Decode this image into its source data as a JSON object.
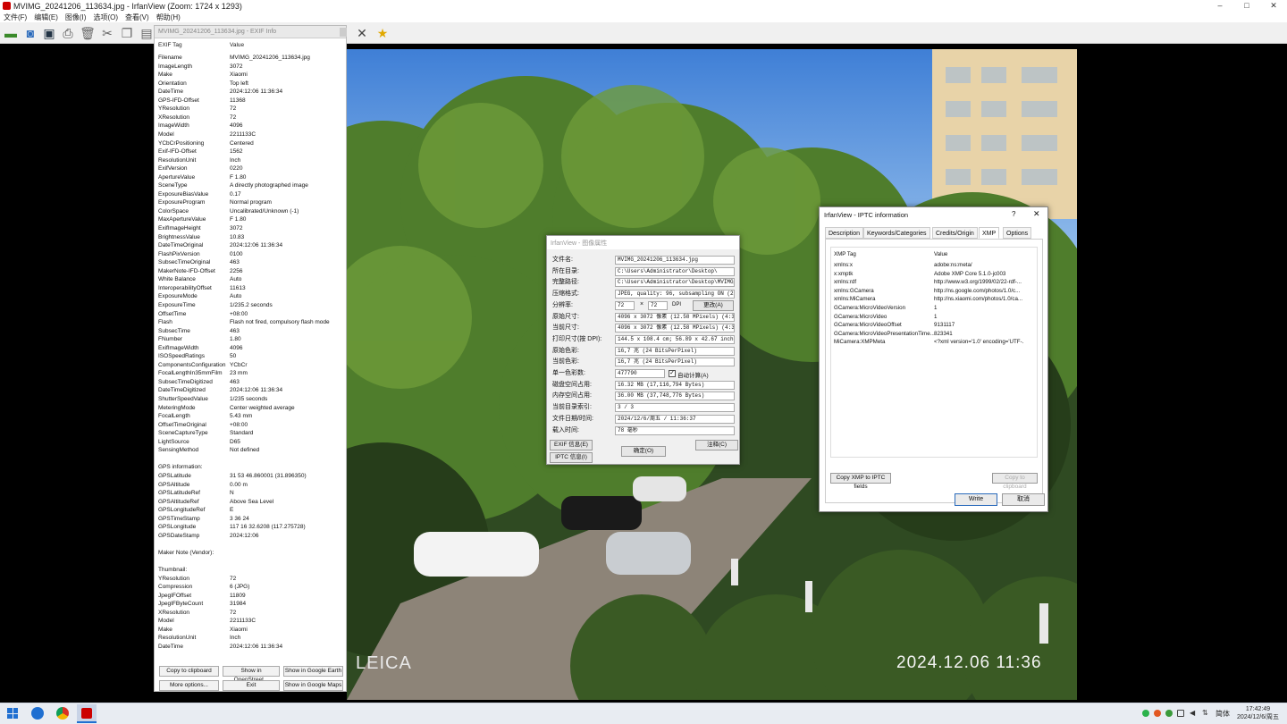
{
  "app": {
    "title": "MVIMG_20241206_113634.jpg - IrfanView (Zoom: 1724 x 1293)",
    "window_buttons": [
      "–",
      "□",
      "✕"
    ],
    "menu": [
      "文件(F)",
      "编辑(E)",
      "图像(I)",
      "选项(O)",
      "查看(V)",
      "帮助(H)"
    ]
  },
  "exif": {
    "title": "MVIMG_20241206_113634.jpg - EXIF Info",
    "col_tag": "EXIF Tag",
    "col_value": "Value",
    "rows": [
      [
        "Filename",
        "MVIMG_20241206_113634.jpg"
      ],
      [
        "ImageLength",
        "3072"
      ],
      [
        "Make",
        "Xiaomi"
      ],
      [
        "Orientation",
        "Top left"
      ],
      [
        "DateTime",
        "2024:12:06 11:36:34"
      ],
      [
        "GPS-IFD-Offset",
        "11368"
      ],
      [
        "YResolution",
        "72"
      ],
      [
        "XResolution",
        "72"
      ],
      [
        "ImageWidth",
        "4096"
      ],
      [
        "Model",
        "2211133C"
      ],
      [
        "YCbCrPositioning",
        "Centered"
      ],
      [
        "Exif-IFD-Offset",
        "1562"
      ],
      [
        "ResolutionUnit",
        "Inch"
      ],
      [
        "ExifVersion",
        "0220"
      ],
      [
        "ApertureValue",
        "F 1.80"
      ],
      [
        "SceneType",
        "A directly photographed image"
      ],
      [
        "ExposureBiasValue",
        "0.17"
      ],
      [
        "ExposureProgram",
        "Normal program"
      ],
      [
        "ColorSpace",
        "Uncalibrated/Unknown (-1)"
      ],
      [
        "MaxApertureValue",
        "F 1.80"
      ],
      [
        "ExifImageHeight",
        "3072"
      ],
      [
        "BrightnessValue",
        "10.83"
      ],
      [
        "DateTimeOriginal",
        "2024:12:06 11:36:34"
      ],
      [
        "FlashPixVersion",
        "0100"
      ],
      [
        "SubsecTimeOriginal",
        "463"
      ],
      [
        "MakerNote-IFD-Offset",
        "2256"
      ],
      [
        "White Balance",
        "Auto"
      ],
      [
        "InteroperabilityOffset",
        "11613"
      ],
      [
        "ExposureMode",
        "Auto"
      ],
      [
        "ExposureTime",
        "1/235.2 seconds"
      ],
      [
        "OffsetTime",
        "+08:00"
      ],
      [
        "Flash",
        "Flash not fired, compulsory flash mode"
      ],
      [
        "SubsecTime",
        "463"
      ],
      [
        "FNumber",
        "1.80"
      ],
      [
        "ExifImageWidth",
        "4096"
      ],
      [
        "ISOSpeedRatings",
        "50"
      ],
      [
        "ComponentsConfiguration",
        "YCbCr"
      ],
      [
        "FocalLengthIn35mmFilm",
        "23 mm"
      ],
      [
        "SubsecTimeDigitized",
        "463"
      ],
      [
        "DateTimeDigitized",
        "2024:12:06 11:36:34"
      ],
      [
        "ShutterSpeedValue",
        "1/235 seconds"
      ],
      [
        "MeteringMode",
        "Center weighted average"
      ],
      [
        "FocalLength",
        "5.43 mm"
      ],
      [
        "OffsetTimeOriginal",
        "+08:00"
      ],
      [
        "SceneCaptureType",
        "Standard"
      ],
      [
        "LightSource",
        "D65"
      ],
      [
        "SensingMethod",
        "Not defined"
      ],
      [
        "",
        ""
      ],
      [
        "GPS information:",
        ""
      ],
      [
        "GPSLatitude",
        "31  53  46.860001 (31.896350)"
      ],
      [
        "GPSAltitude",
        "0.00 m"
      ],
      [
        "GPSLatitudeRef",
        "N"
      ],
      [
        "GPSAltitudeRef",
        "Above Sea Level"
      ],
      [
        "GPSLongitudeRef",
        "E"
      ],
      [
        "GPSTimeStamp",
        "3  36  24"
      ],
      [
        "GPSLongitude",
        "117  16  32.6208 (117.275728)"
      ],
      [
        "GPSDateStamp",
        "2024:12:06"
      ],
      [
        "",
        ""
      ],
      [
        "Maker Note (Vendor):",
        ""
      ],
      [
        "",
        ""
      ],
      [
        "Thumbnail:",
        ""
      ],
      [
        "YResolution",
        "72"
      ],
      [
        "Compression",
        "6 (JPG)"
      ],
      [
        "JpegIFOffset",
        "11809"
      ],
      [
        "JpegIFByteCount",
        "31984"
      ],
      [
        "XResolution",
        "72"
      ],
      [
        "Model",
        "2211133C"
      ],
      [
        "Make",
        "Xiaomi"
      ],
      [
        "ResolutionUnit",
        "Inch"
      ],
      [
        "DateTime",
        "2024:12:06 11:36:34"
      ]
    ],
    "buttons": {
      "copy": "Copy to clipboard",
      "openstreet": "Show in OpenStreet...",
      "google_earth": "Show in Google Earth",
      "more": "More options...",
      "exit": "Exit",
      "google_maps": "Show in Google Maps"
    }
  },
  "props": {
    "title": "IrfanView - 图像属性",
    "rows": [
      [
        "文件名:",
        "MVIMG_20241206_113634.jpg"
      ],
      [
        "所在目录:",
        "C:\\Users\\Administrator\\Desktop\\"
      ],
      [
        "完整路径:",
        "C:\\Users\\Administrator\\Desktop\\MVIMG_20"
      ],
      [
        "压缩格式:",
        "JPEG, quality: 96, subsampling ON (2x2)"
      ],
      [
        "分辨率:",
        ""
      ],
      [
        "原始尺寸:",
        "4096 x 3072  像素 (12.58 MPixels) (4:3)"
      ],
      [
        "当前尺寸:",
        "4096 x 3072  像素 (12.58 MPixels) (4:3)"
      ],
      [
        "打印尺寸(按 DPI):",
        "144.5 x 108.4 cm; 56.89 x 42.67 inches"
      ],
      [
        "原始色彩:",
        "16,7 兆   (24 BitsPerPixel)"
      ],
      [
        "当前色彩:",
        "16,7 兆   (24 BitsPerPixel)"
      ],
      [
        "单一色彩数:",
        ""
      ],
      [
        "磁盘空间占用:",
        "16.32 MB (17,116,794 Bytes)"
      ],
      [
        "内存空间占用:",
        "36.00  MB (37,748,776 Bytes)"
      ],
      [
        "当前目录索引:",
        "3  /  3"
      ],
      [
        "文件日期/时间:",
        "2024/12/6/周五 / 11:36:37"
      ],
      [
        "载入时间:",
        "78 毫秒"
      ]
    ],
    "dpi_x": "72",
    "dpi_y": "72",
    "dpi_label": "DPI",
    "change_btn": "更改(A)",
    "unique_colors": "477790",
    "auto_calc": "自动计算(A)",
    "exif_btn": "EXIF 信息(E)",
    "iptc_btn": "IPTC 信息(I)",
    "ok_btn": "确定(O)",
    "comment_btn": "注释(C)"
  },
  "iptc": {
    "title": "IrfanView - IPTC information",
    "help": "?",
    "close": "✕",
    "tabs": [
      "Description",
      "Keywords/Categories",
      "Credits/Origin",
      "XMP",
      "Options"
    ],
    "col_tag": "XMP Tag",
    "col_value": "Value",
    "rows": [
      [
        "xmlns:x",
        "adobe:ns:meta/"
      ],
      [
        "x:xmptk",
        "Adobe XMP Core 5.1.0-jc003"
      ],
      [
        "xmlns:rdf",
        "http://www.w3.org/1999/02/22-rdf-..."
      ],
      [
        "xmlns:GCamera",
        "http://ns.google.com/photos/1.0/c..."
      ],
      [
        "xmlns:MiCamera",
        "http://ns.xiaomi.com/photos/1.0/ca..."
      ],
      [
        "GCamera:MicroVideoVersion",
        "1"
      ],
      [
        "GCamera:MicroVideo",
        "1"
      ],
      [
        "GCamera:MicroVideoOffset",
        "9131117"
      ],
      [
        "GCamera:MicroVideoPresentationTime...",
        "823341"
      ],
      [
        "MiCamera:XMPMeta",
        "<?xml version='1.0' encoding='UTF-..."
      ]
    ],
    "copy_xmp": "Copy XMP to IPTC fields",
    "copy_clip": "Copy to clipboard",
    "write": "Write",
    "cancel": "取消"
  },
  "photo": {
    "watermark": "LEICA",
    "timestamp": "2024.12.06   11:36"
  },
  "taskbar": {
    "lang": "简体",
    "time": "17:42:49",
    "date": "2024/12/6/周五"
  }
}
